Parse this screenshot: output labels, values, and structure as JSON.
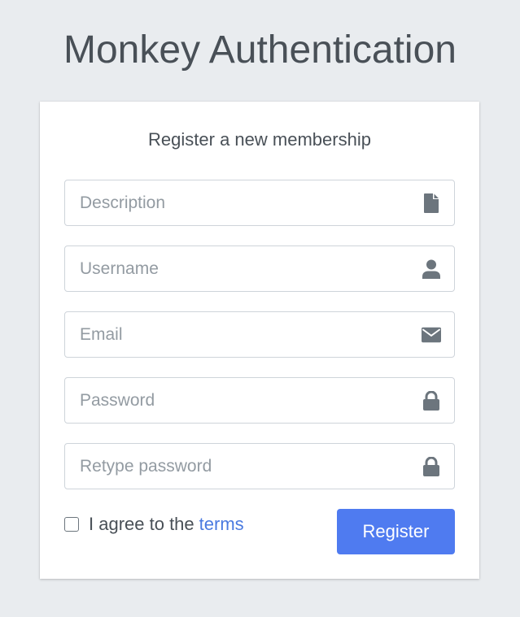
{
  "app": {
    "title": "Monkey Authentication"
  },
  "card": {
    "message": "Register a new membership"
  },
  "fields": [
    {
      "placeholder": "Description",
      "icon": "file-icon"
    },
    {
      "placeholder": "Username",
      "icon": "user-icon"
    },
    {
      "placeholder": "Email",
      "icon": "envelope-icon"
    },
    {
      "placeholder": "Password",
      "icon": "lock-icon"
    },
    {
      "placeholder": "Retype password",
      "icon": "lock-icon"
    }
  ],
  "terms": {
    "prefix": "I agree to the",
    "link": "terms",
    "checked": false
  },
  "actions": {
    "register_label": "Register"
  },
  "colors": {
    "background": "#e9ecef",
    "primary": "#4f7bf0",
    "link": "#4a7ae0",
    "icon": "#6c757d"
  }
}
